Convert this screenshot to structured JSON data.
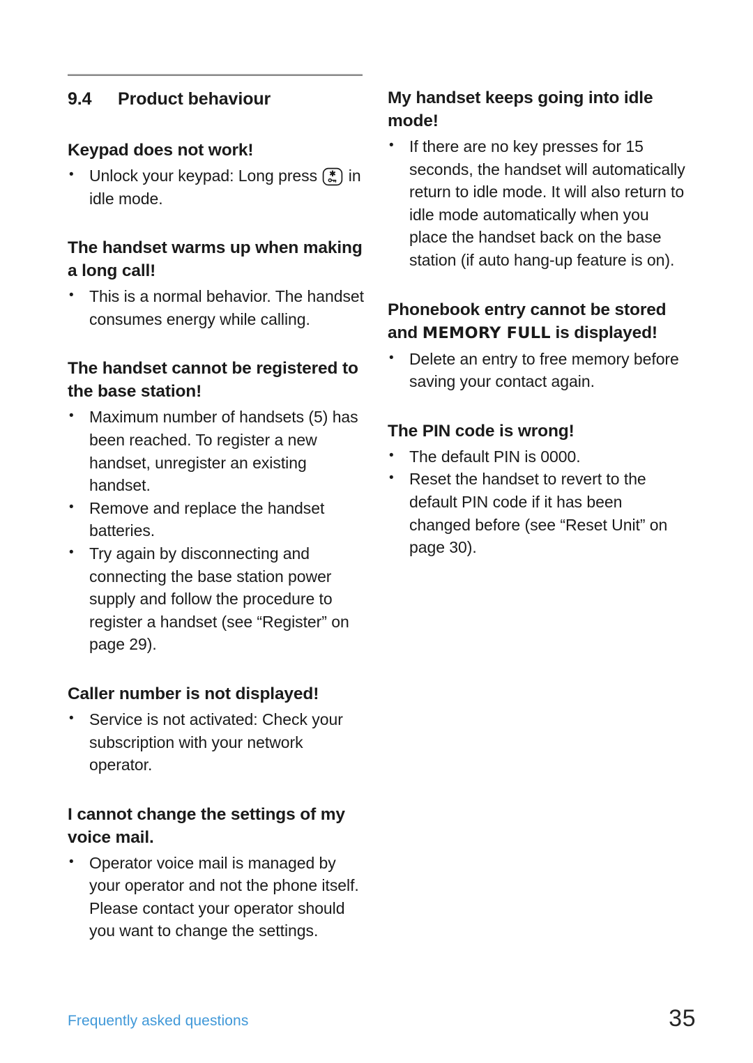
{
  "colors": {
    "footer_link": "#4098d8",
    "rule": "#8a8a8a",
    "text": "#1a1a1a",
    "page_number": "#262626"
  },
  "section": {
    "number": "9.4",
    "title": "Product behaviour"
  },
  "left_column": {
    "blocks": [
      {
        "heading": "Keypad does not work!",
        "items": [
          {
            "before": "Unlock your keypad: Long press ",
            "icon": "star-key-lock-icon",
            "after": " in idle mode."
          }
        ]
      },
      {
        "heading": "The handset warms up when making a long call!",
        "items": [
          {
            "text": "This is a normal behavior. The handset consumes energy while calling."
          }
        ]
      },
      {
        "heading": "The handset cannot be registered to the base station!",
        "items": [
          {
            "text": "Maximum number of handsets (5) has been reached. To register a new handset, unregister an existing handset."
          },
          {
            "text": "Remove and replace the handset batteries."
          },
          {
            "text": "Try again by disconnecting and connecting the base station power supply and follow the procedure to register a handset (see “Register” on page 29)."
          }
        ]
      },
      {
        "heading": "Caller number is not displayed!",
        "items": [
          {
            "text": "Service is not activated: Check your subscription with your network operator."
          }
        ]
      },
      {
        "heading": "I cannot change the settings of my voice mail.",
        "items": [
          {
            "text": "Operator voice mail is managed by your operator and not the phone itself. Please contact your operator should you want to change the settings."
          }
        ]
      }
    ]
  },
  "right_column": {
    "blocks": [
      {
        "heading": "My handset keeps going into idle mode!",
        "items": [
          {
            "text": "If there are no key presses for 15 seconds, the handset will automatically return to idle mode. It will also return to idle mode automatically when you place the handset back on the base station (if auto hang-up feature is on)."
          }
        ]
      },
      {
        "heading_parts": {
          "before": "Phonebook entry cannot be stored and ",
          "display": "MEMORY FULL",
          "after": " is displayed!"
        },
        "items": [
          {
            "text": "Delete an entry to free memory before saving your contact again."
          }
        ]
      },
      {
        "heading": "The PIN code is wrong!",
        "items": [
          {
            "text": "The default PIN is 0000."
          },
          {
            "text": "Reset the handset to revert to the default PIN code if it has been changed before (see “Reset Unit” on page 30)."
          }
        ]
      }
    ]
  },
  "footer": {
    "chapter_label": "Frequently asked questions",
    "page_number": "35"
  }
}
